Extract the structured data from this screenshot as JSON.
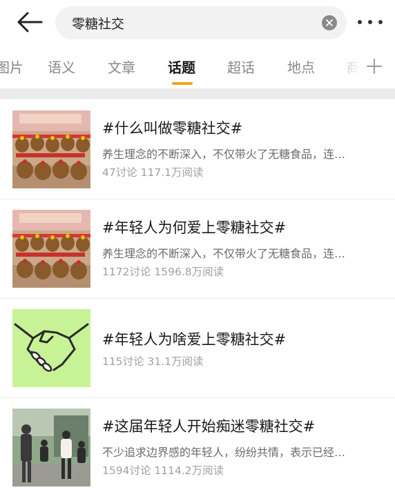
{
  "search": {
    "query": "零糖社交"
  },
  "tabs": [
    {
      "label": "图片"
    },
    {
      "label": "语义"
    },
    {
      "label": "文章"
    },
    {
      "label": "话题"
    },
    {
      "label": "超话"
    },
    {
      "label": "地点"
    },
    {
      "label": "商"
    }
  ],
  "active_tab": "话题",
  "accent_color": "#f5a51a",
  "results": [
    {
      "title": "#什么叫做零糖社交#",
      "desc": "养生理念的不断深入，不仅带火了无糖食品，连…",
      "stats": "47讨论 117.1万阅读",
      "thumb_icon": "plush-toys-image"
    },
    {
      "title": "#年轻人为何爱上零糖社交#",
      "desc": "养生理念的不断深入，不仅带火了无糖食品，连…",
      "stats": "1172讨论 1596.8万阅读",
      "thumb_icon": "plush-toys-image"
    },
    {
      "title": "#年轻人为啥爱上零糖社交#",
      "desc": "",
      "stats": "115讨论 31.1万阅读",
      "thumb_icon": "handshake-image"
    },
    {
      "title": "#这届年轻人开始痴迷零糖社交#",
      "desc": "不少追求边界感的年轻人，纷纷共情，表示已经…",
      "stats": "1594讨论 1114.2万阅读",
      "thumb_icon": "people-photo-image"
    }
  ]
}
